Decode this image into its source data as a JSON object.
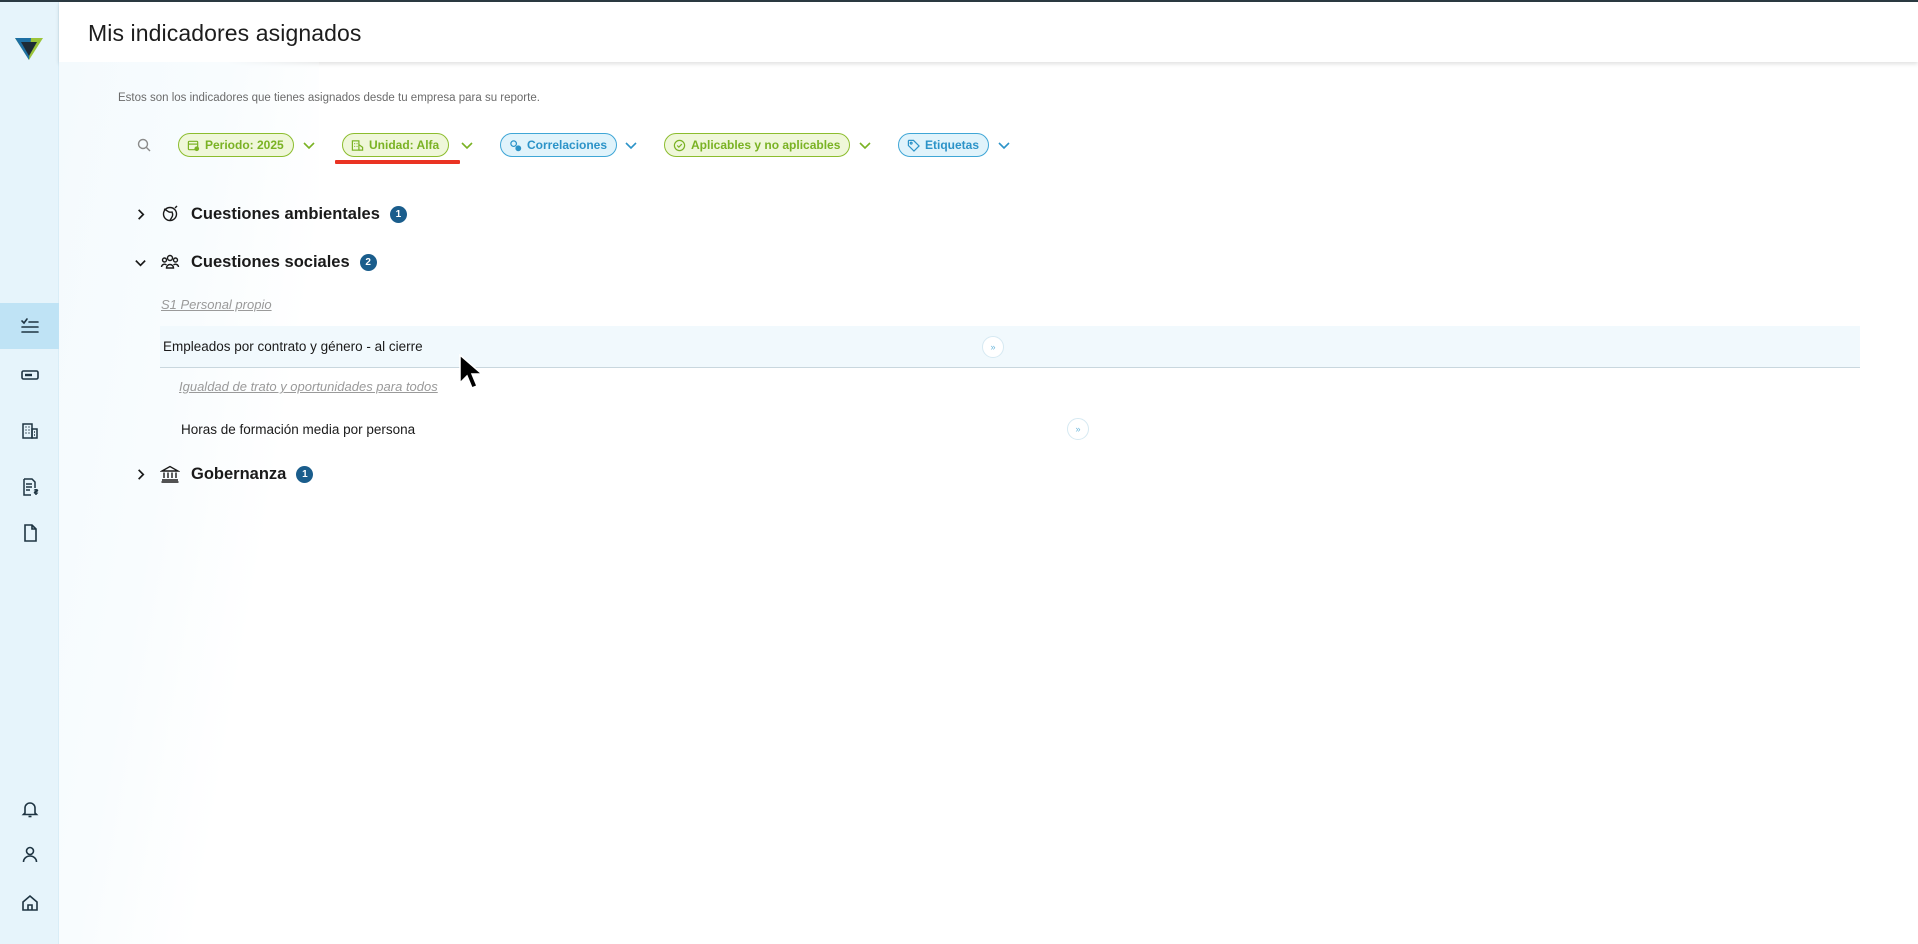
{
  "page": {
    "title": "Mis indicadores asignados",
    "subtitle": "Estos son los indicadores que tienes asignados desde tu empresa para su reporte."
  },
  "colors": {
    "sidebar_bg": "#e6f4fb",
    "sidebar_active": "#bfe3f5",
    "green_chip": "#8cbd2e",
    "blue_chip": "#3fa6d6",
    "badge": "#1a5d8c",
    "highlight_underline": "#ea3323"
  },
  "sidebar": {
    "logo": "triangle-logo",
    "items": [
      {
        "icon": "checklist-icon",
        "active": true
      },
      {
        "icon": "card-icon",
        "active": false
      },
      {
        "icon": "building-icon",
        "active": false
      },
      {
        "icon": "invoice-icon",
        "active": false
      },
      {
        "icon": "document-icon",
        "active": false
      }
    ],
    "bottom_items": [
      {
        "icon": "bell-icon"
      },
      {
        "icon": "user-icon"
      },
      {
        "icon": "home-icon"
      }
    ]
  },
  "filters": {
    "search_icon": "search-icon",
    "chips": [
      {
        "label": "Periodo: 2025",
        "icon": "calendar-icon",
        "color": "green"
      },
      {
        "label": "Unidad: Alfa",
        "icon": "buildings-icon",
        "color": "green"
      },
      {
        "label": "Correlaciones",
        "icon": "correlation-icon",
        "color": "blue"
      },
      {
        "label": "Aplicables y no aplicables",
        "icon": "check-circle-icon",
        "color": "green"
      },
      {
        "label": "Etiquetas",
        "icon": "tag-icon",
        "color": "blue"
      }
    ]
  },
  "tree": {
    "categories": [
      {
        "label": "Cuestiones ambientales",
        "count": "1",
        "expanded": false,
        "icon": "eco-icon"
      },
      {
        "label": "Cuestiones sociales",
        "count": "2",
        "expanded": true,
        "icon": "people-icon"
      },
      {
        "label": "Gobernanza",
        "count": "1",
        "expanded": false,
        "icon": "bank-icon"
      }
    ],
    "social": {
      "section1": "S1 Personal propio",
      "indicator1": "Empleados por contrato y género - al cierre",
      "section2": "Igualdad de trato y oportunidades para todos",
      "indicator2": "Horas de formación media por persona"
    }
  }
}
